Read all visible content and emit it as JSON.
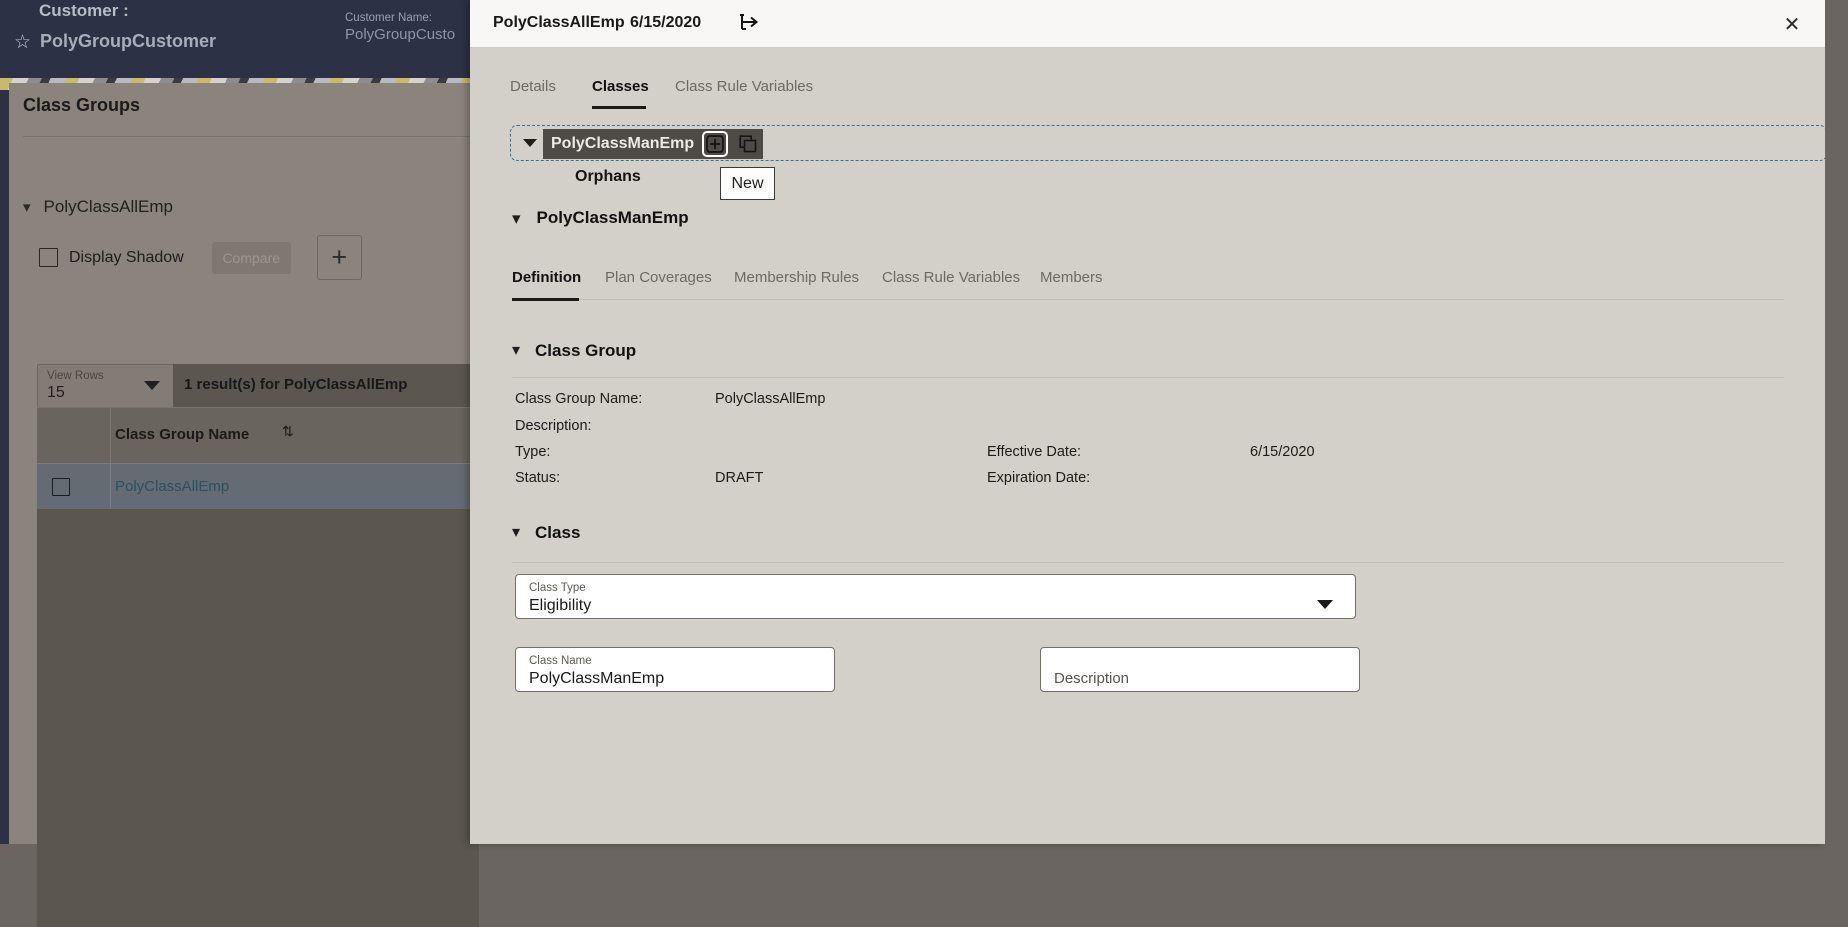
{
  "background_app": {
    "customer_header": {
      "label": "Customer :",
      "name": "PolyGroupCustomer",
      "star_icon": "star-icon",
      "customer_name_label": "Customer Name:",
      "customer_name_value": "PolyGroupCusto"
    },
    "card": {
      "title": "Class Groups",
      "group_name": "PolyClassAllEmp",
      "display_shadow_label": "Display Shadow",
      "compare_label": "Compare",
      "add_label": "+",
      "view_rows_label": "View Rows",
      "view_rows_value": "15",
      "results_text": "1 result(s) for PolyClassAllEmp",
      "table": {
        "columns": [
          "",
          "Class Group Name"
        ],
        "rows": [
          {
            "checked": false,
            "class_group_name": "PolyClassAllEmp"
          }
        ]
      }
    }
  },
  "modal": {
    "header": {
      "title": "PolyClassAllEmp",
      "date": "6/15/2020",
      "expand_icon": "branch-arrow-icon",
      "close_icon": "close-icon"
    },
    "tabs": [
      {
        "label": "Details",
        "active": false
      },
      {
        "label": "Classes",
        "active": true
      },
      {
        "label": "Class Rule Variables",
        "active": false
      }
    ],
    "tree_row": {
      "caret_icon": "chevron-down-icon",
      "node_label": "PolyClassManEmp",
      "add_icon": "plus-square-icon",
      "copy_icon": "copy-icon"
    },
    "orphans_label": "Orphans",
    "new_button_label": "New",
    "class_header": {
      "caret_icon": "chevron-down-icon",
      "label": "PolyClassManEmp"
    },
    "sub_tabs": [
      {
        "label": "Definition",
        "active": true
      },
      {
        "label": "Plan Coverages",
        "active": false
      },
      {
        "label": "Membership Rules",
        "active": false
      },
      {
        "label": "Class Rule Variables",
        "active": false
      },
      {
        "label": "Members",
        "active": false
      }
    ],
    "class_group_section": {
      "title": "Class Group",
      "fields": [
        {
          "label": "Class Group Name:",
          "value": "PolyClassAllEmp"
        },
        {
          "label": "Description:",
          "value": ""
        },
        {
          "label": "Type:",
          "value": ""
        },
        {
          "label": "Status:",
          "value": "DRAFT"
        }
      ],
      "right_fields": [
        {
          "label": "Effective Date:",
          "value": "6/15/2020"
        },
        {
          "label": "Expiration Date:",
          "value": ""
        }
      ]
    },
    "class_section": {
      "title": "Class",
      "class_type": {
        "label": "Class Type",
        "value": "Eligibility",
        "caret_icon": "chevron-down-icon"
      },
      "class_name": {
        "label": "Class Name",
        "value": "PolyClassManEmp"
      },
      "description": {
        "placeholder": "Description",
        "value": ""
      }
    }
  },
  "colors": {
    "modal_bg": "#d3cfc9",
    "header_bg": "#f8f7f5",
    "dark_navy": "#2c3145",
    "focus_dash": "#3b6f8e",
    "chip_dark": "#4e4a45",
    "link_blue": "#2b5162"
  }
}
